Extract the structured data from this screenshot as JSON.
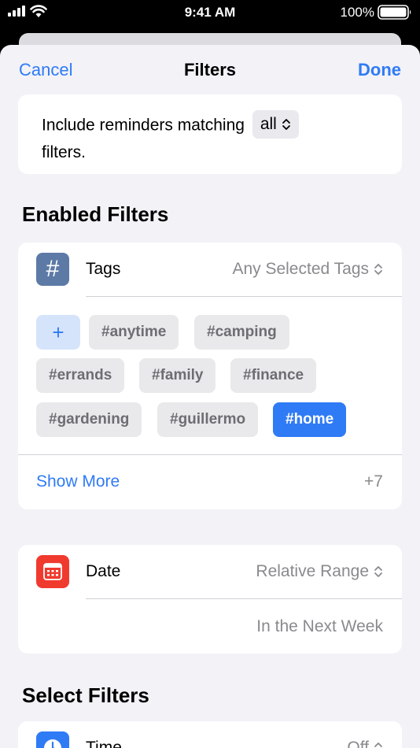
{
  "status": {
    "time": "9:41 AM",
    "battery": "100%"
  },
  "nav": {
    "cancel": "Cancel",
    "title": "Filters",
    "done": "Done"
  },
  "match": {
    "prefix": "Include reminders matching",
    "selector": "all",
    "suffix": "filters."
  },
  "enabled_title": "Enabled Filters",
  "tags_filter": {
    "icon": "#",
    "label": "Tags",
    "value": "Any Selected Tags",
    "add_label": "+",
    "tags": [
      {
        "label": "#anytime",
        "selected": false
      },
      {
        "label": "#camping",
        "selected": false
      },
      {
        "label": "#errands",
        "selected": false
      },
      {
        "label": "#family",
        "selected": false
      },
      {
        "label": "#finance",
        "selected": false
      },
      {
        "label": "#gardening",
        "selected": false
      },
      {
        "label": "#guillermo",
        "selected": false
      },
      {
        "label": "#home",
        "selected": true
      }
    ],
    "show_more": "Show More",
    "more_count": "+7"
  },
  "date_filter": {
    "label": "Date",
    "value": "Relative Range",
    "sub_value": "In the Next Week"
  },
  "select_title": "Select Filters",
  "time_filter": {
    "label": "Time",
    "value": "Off"
  },
  "colors": {
    "accent": "#2f7bf5",
    "tag_icon": "#5c7aa5",
    "date_icon": "#f03a2e"
  }
}
